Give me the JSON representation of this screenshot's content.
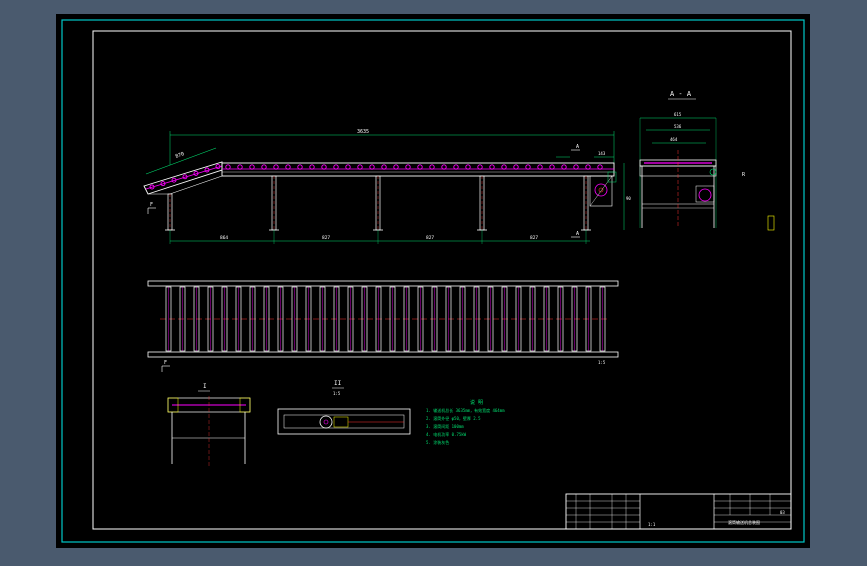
{
  "colors": {
    "background": "#4a5a6e",
    "paper": "#000000",
    "frame": "#00c8c8",
    "line": "#ffffff",
    "roller": "#ff00ff",
    "dimension": "#00e070",
    "centerline": "#ff3030",
    "annotation": "#ffff00"
  },
  "side_view": {
    "overall_length": "3635",
    "incline_length": "870",
    "height_small": "143",
    "leg_spacing": [
      "864",
      "827",
      "827",
      "827"
    ],
    "section_marker": "A",
    "section_dim": "90",
    "end_label": "F"
  },
  "section_view": {
    "title": "A - A",
    "width_outer": "615",
    "width_mid": "536",
    "width_inner": "464",
    "tag": "R"
  },
  "top_view": {
    "label": "F",
    "scale_note": "1:5"
  },
  "detail_views": {
    "detail1_label": "I",
    "detail2_label": "II",
    "detail2_scale": "1:5"
  },
  "notes": {
    "title": "说 明",
    "lines": [
      "1. 输送机总长 3635mm，有效宽度 464mm",
      "2. 滚筒外径 φ50，壁厚 2.5",
      "3. 滚筒间距 100mm",
      "4. 电机功率 0.75kW",
      "5. 涂装灰色"
    ]
  },
  "title_block": {
    "drawing_name": "滚筒输送机总装图",
    "scale": "1:1",
    "part_code": "03"
  }
}
